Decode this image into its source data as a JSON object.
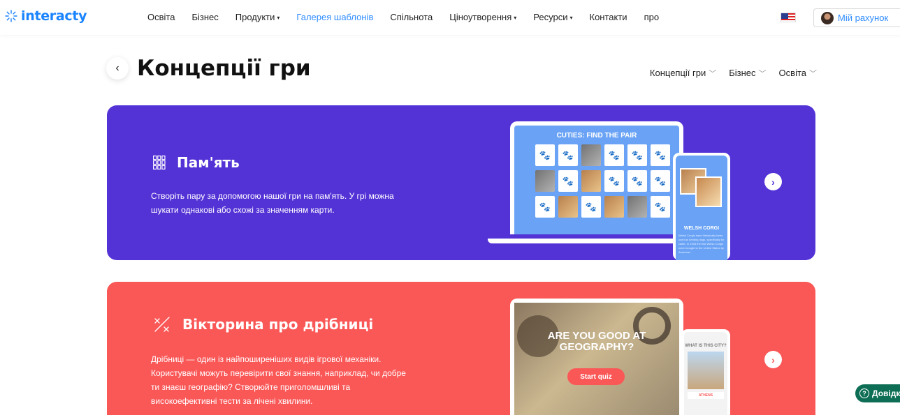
{
  "brand": {
    "name": "interacty",
    "color": "#1a84ff"
  },
  "nav": {
    "items": [
      {
        "label": "Освіта",
        "caret": false,
        "active": false
      },
      {
        "label": "Бізнес",
        "caret": false,
        "active": false
      },
      {
        "label": "Продукти",
        "caret": true,
        "active": false
      },
      {
        "label": "Галерея шаблонів",
        "caret": false,
        "active": true
      },
      {
        "label": "Спільнота",
        "caret": false,
        "active": false
      },
      {
        "label": "Ціноутворення",
        "caret": true,
        "active": false
      },
      {
        "label": "Ресурси",
        "caret": true,
        "active": false
      },
      {
        "label": "Контакти",
        "caret": false,
        "active": false
      },
      {
        "label": "про",
        "caret": false,
        "active": false
      }
    ],
    "caret_icon": "▾"
  },
  "account": {
    "label": "Мій рахунок",
    "icon": "user-avatar"
  },
  "language": {
    "icon": "us-flag-icon"
  },
  "page": {
    "title": "Концепції гри",
    "back_icon": "‹"
  },
  "filters": [
    {
      "label": "Концепції гри"
    },
    {
      "label": "Бізнес"
    },
    {
      "label": "Освіта"
    }
  ],
  "cards": {
    "memory": {
      "title": "Пам'ять",
      "icon": "grid-icon",
      "description": "Створіть пару за допомогою нашої гри на пам'ять. У грі можна шукати однакові або схожі за значенням карти.",
      "color": "#5433d6",
      "preview": {
        "game_title": "CUTIES: FIND THE PAIR",
        "phone_caption": "WELSH CORGI",
        "phone_text": "Welsh Corgis have historically been used as herding dogs, specifically for cattle. In 1933 the first Welsh Corgis were brought to the United States by American"
      }
    },
    "trivia": {
      "title": "Вікторина про дрібниці",
      "icon": "percent-cross-icon",
      "description": "Дрібниці — один із найпоширеніших видів ігрової механіки. Користувачі можуть перевірити свої знання, наприклад, чи добре ти знаєш географію? Створюйте приголомшливі та високоефективні тести за лічені хвилини.",
      "color": "#fa5757",
      "preview": {
        "headline": "ARE YOU GOOD AT GEOGRAPHY?",
        "button": "Start quiz",
        "phone_question": "WHAT IS THIS CITY?",
        "phone_answer": "ATHENS"
      }
    }
  },
  "help": {
    "label": "Довідка",
    "icon": "question-circle-icon"
  },
  "arrow_icon": "›"
}
